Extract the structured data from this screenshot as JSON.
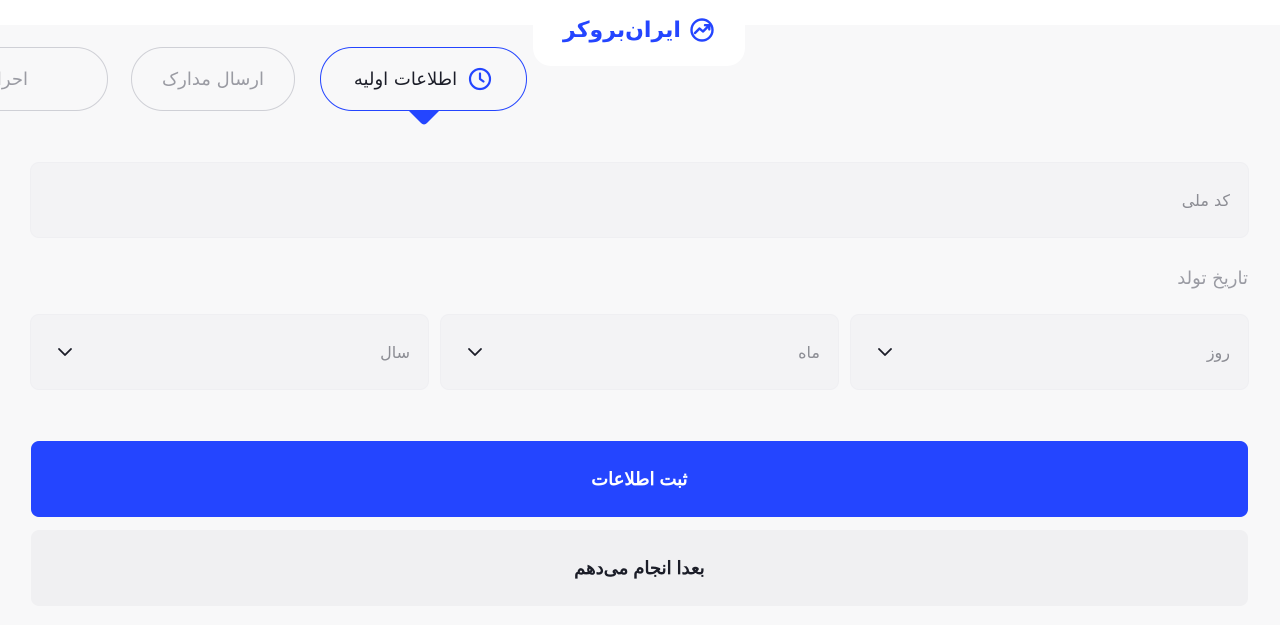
{
  "brand": {
    "logo_text": "ایران‌بروکر",
    "accent_color": "#2445ff",
    "logo_icon": "trend-chart-icon"
  },
  "steps": [
    {
      "label": "اطلاعات اولیه",
      "state": "active",
      "icon": "clock-icon"
    },
    {
      "label": "ارسال مدارک",
      "state": "inactive"
    },
    {
      "label": "احراز هویت",
      "state": "inactive"
    }
  ],
  "form": {
    "national_id": {
      "placeholder": "کد ملی"
    },
    "birth_date": {
      "label": "تاریخ تولد",
      "day": {
        "placeholder": "روز",
        "icon": "chevron-down-icon"
      },
      "month": {
        "placeholder": "ماه",
        "icon": "chevron-down-icon"
      },
      "year": {
        "placeholder": "سال",
        "icon": "chevron-down-icon"
      }
    },
    "submit_label": "ثبت اطلاعات",
    "later_label": "بعدا انجام می‌دهم"
  }
}
